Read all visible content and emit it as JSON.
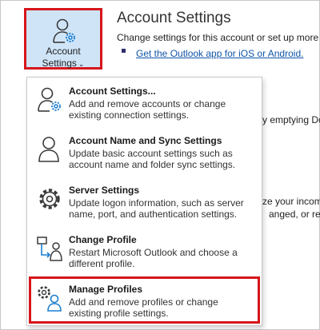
{
  "account_button": {
    "line1": "Account",
    "line2": "Settings",
    "chevron": "⌄",
    "icon": "user-gear-icon"
  },
  "header": {
    "title": "Account Settings",
    "description": "Change settings for this account or set up more",
    "link": "Get the Outlook app for iOS or Android."
  },
  "background_fragments": [
    "y emptying Do",
    "ze your incom",
    "anged, or rem"
  ],
  "menu": {
    "items": [
      {
        "title": "Account Settings...",
        "line1": "Add and remove accounts or change",
        "line2": "existing connection settings.",
        "icon": "user-gear-icon"
      },
      {
        "title": "Account Name and Sync Settings",
        "line1": "Update basic account settings such as",
        "line2": "account name and folder sync settings.",
        "icon": "user-icon"
      },
      {
        "title": "Server Settings",
        "line1": "Update logon information, such as server",
        "line2": "name, port, and authentication settings.",
        "icon": "gear-icon"
      },
      {
        "title": "Change Profile",
        "line1": "Restart Microsoft Outlook and choose a",
        "line2": "different profile.",
        "icon": "switch-profile-icon"
      },
      {
        "title": "Manage Profiles",
        "line1": "Add and remove profiles or change",
        "line2": "existing profile settings.",
        "icon": "gear-user-icon"
      }
    ]
  },
  "colors": {
    "highlight_border": "#d6161b",
    "button_bg": "#cfe4f7",
    "link": "#1155a8",
    "icon_accent": "#1c7fd1"
  }
}
